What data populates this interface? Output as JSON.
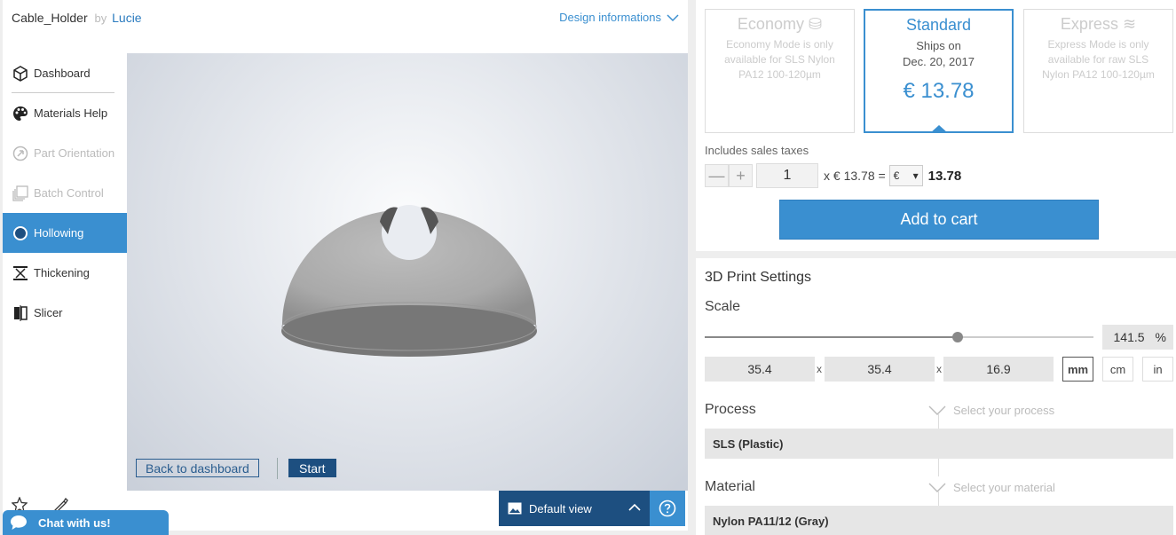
{
  "header": {
    "project_name": "Cable_Holder",
    "by_label": "by",
    "author": "Lucie",
    "design_info_label": "Design informations"
  },
  "sidebar": {
    "items": [
      {
        "label": "Dashboard",
        "icon": "cube-icon",
        "state": "normal"
      },
      {
        "label": "Materials Help",
        "icon": "palette-icon",
        "state": "normal"
      },
      {
        "label": "Part Orientation",
        "icon": "orientation-icon",
        "state": "disabled"
      },
      {
        "label": "Batch Control",
        "icon": "batch-icon",
        "state": "disabled"
      },
      {
        "label": "Hollowing",
        "icon": "hollow-circle-icon",
        "state": "active"
      },
      {
        "label": "Thickening",
        "icon": "thickening-icon",
        "state": "normal"
      },
      {
        "label": "Slicer",
        "icon": "slicer-icon",
        "state": "normal"
      }
    ]
  },
  "viewer": {
    "back_label": "Back to dashboard",
    "start_label": "Start",
    "default_view_label": "Default view"
  },
  "chat": {
    "label": "Chat with us!"
  },
  "modes": {
    "economy": {
      "title": "Economy",
      "desc": "Economy Mode is only available for SLS Nylon PA12 100-120µm"
    },
    "standard": {
      "title": "Standard",
      "desc_line1": "Ships on",
      "desc_line2": "Dec. 20, 2017",
      "price": "€ 13.78"
    },
    "express": {
      "title": "Express",
      "desc": "Express Mode is only available for raw SLS Nylon PA12 100-120µm"
    }
  },
  "cart": {
    "tax_note": "Includes sales taxes",
    "minus": "—",
    "plus": "+",
    "quantity": "1",
    "unit_price_text": "x € 13.78 =",
    "currency": "€",
    "total": "13.78",
    "add_label": "Add to cart"
  },
  "print_settings": {
    "title": "3D Print Settings",
    "scale_label": "Scale",
    "scale_value": "141.5",
    "scale_unit": "%",
    "slider_fraction": 0.65,
    "dims": {
      "x": "35.4",
      "y": "35.4",
      "z": "16.9"
    },
    "times": "x",
    "units": [
      "mm",
      "cm",
      "in"
    ],
    "selected_unit": "mm",
    "process_label": "Process",
    "process_hint": "Select your process",
    "process_value": "SLS (Plastic)",
    "material_label": "Material",
    "material_hint": "Select your material",
    "material_value": "Nylon PA11/12 (Gray)"
  },
  "colors": {
    "accent": "#3a8fd0",
    "dark_blue": "#1d4f80",
    "model_gray": "#a8a8a8"
  }
}
